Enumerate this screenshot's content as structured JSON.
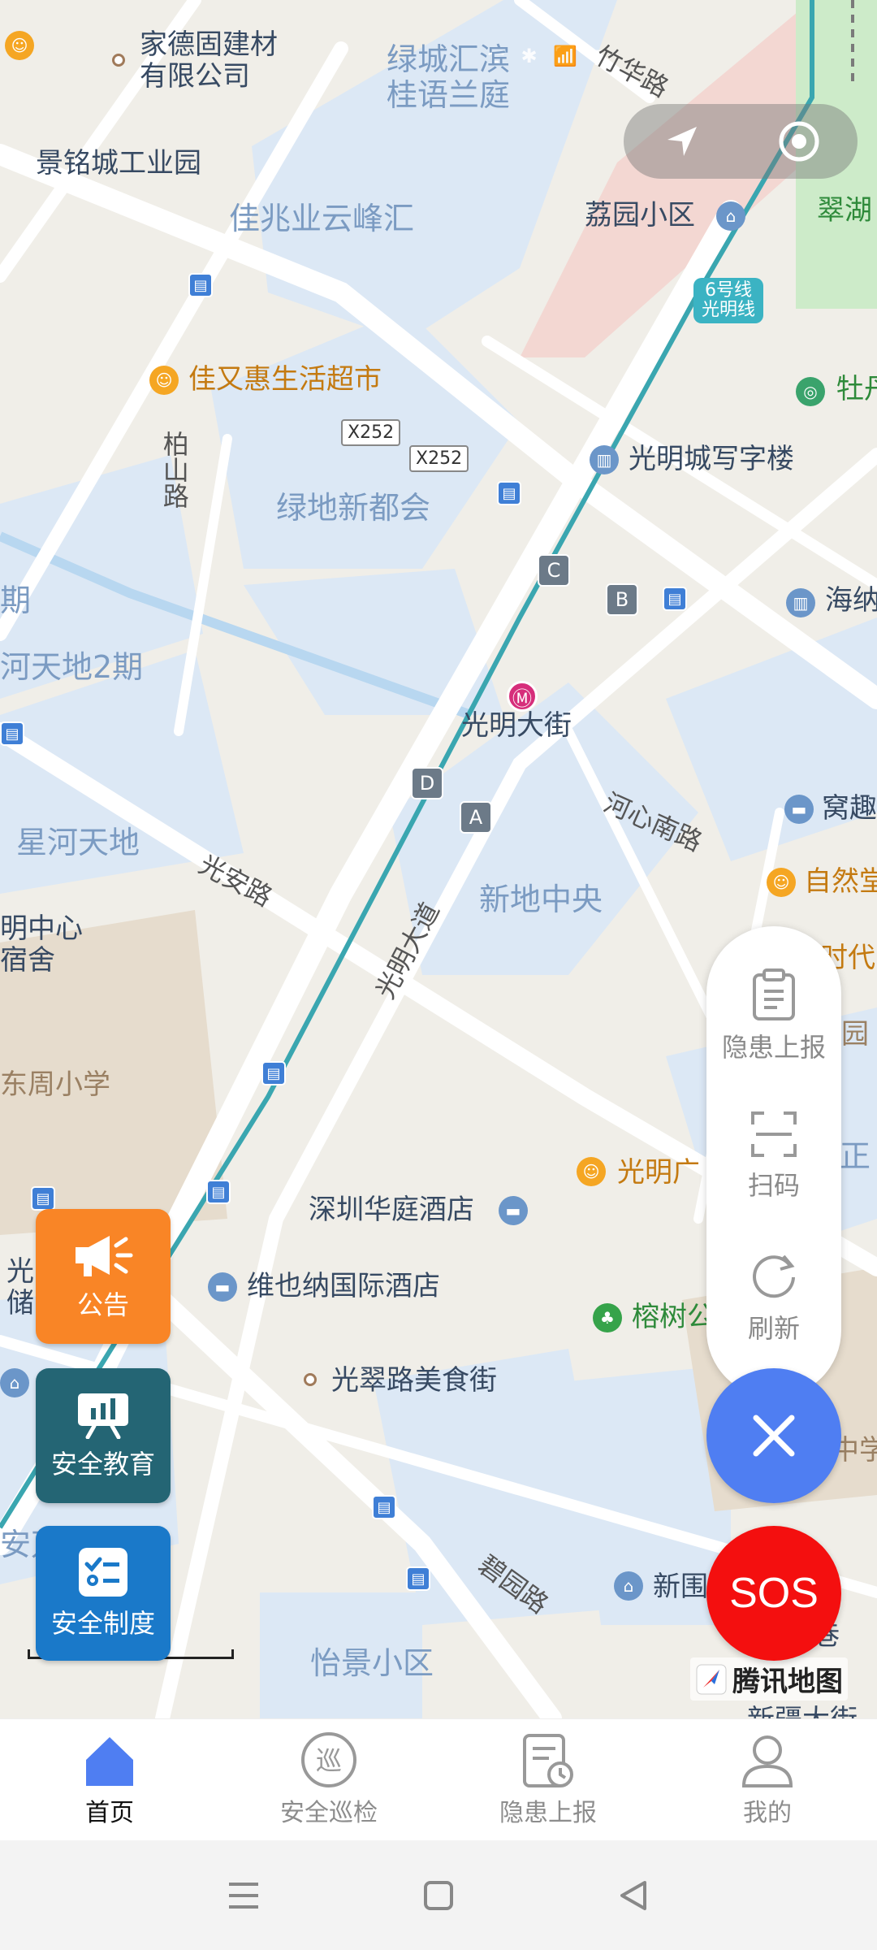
{
  "status_bar": {
    "icons_text": "ᯤ ✱ 📶 ▮"
  },
  "map": {
    "labels": [
      {
        "text": "家德固建材\n有限公司"
      },
      {
        "text": "绿城汇滨\n桂语兰庭"
      },
      {
        "text": "竹华路"
      },
      {
        "text": "景铭城工业园"
      },
      {
        "text": "佳兆业云峰汇"
      },
      {
        "text": "荔园小区"
      },
      {
        "text": "翠湖"
      },
      {
        "text": "佳又惠生活超市"
      },
      {
        "text": "牡丹"
      },
      {
        "text": "柏山路"
      },
      {
        "text": "光明城写字楼"
      },
      {
        "text": "绿地新都会"
      },
      {
        "text": "期"
      },
      {
        "text": "海纳"
      },
      {
        "text": "河天地2期"
      },
      {
        "text": "光明大街"
      },
      {
        "text": "河心南路"
      },
      {
        "text": "窝趣"
      },
      {
        "text": "星河天地"
      },
      {
        "text": "光安路"
      },
      {
        "text": "自然堂"
      },
      {
        "text": "新地中央"
      },
      {
        "text": "明中心\n宿舍"
      },
      {
        "text": "光明大道"
      },
      {
        "text": "时代"
      },
      {
        "text": "园"
      },
      {
        "text": "东周小学"
      },
      {
        "text": "光明广"
      },
      {
        "text": "正"
      },
      {
        "text": "深圳华庭酒店"
      },
      {
        "text": "光\n储"
      },
      {
        "text": "维也纳国际酒店"
      },
      {
        "text": "榕树公"
      },
      {
        "text": "光翠路美食街"
      },
      {
        "text": "中学"
      },
      {
        "text": "安万庭"
      },
      {
        "text": "碧园路"
      },
      {
        "text": "新围"
      },
      {
        "text": "巷"
      },
      {
        "text": "怡景小区"
      },
      {
        "text": "新疆大街"
      }
    ],
    "road_shields": [
      "X252",
      "X252"
    ],
    "metro_line": "6号线\n光明线",
    "station_exits": [
      "C",
      "B",
      "D",
      "A"
    ]
  },
  "fab_menu": {
    "items": [
      {
        "label": "隐患上报",
        "icon": "clipboard-icon"
      },
      {
        "label": "扫码",
        "icon": "scan-icon"
      },
      {
        "label": "刷新",
        "icon": "refresh-icon"
      }
    ],
    "close_icon": "close-icon",
    "sos_label": "SOS"
  },
  "quick_actions": [
    {
      "label": "公告",
      "icon": "megaphone-icon"
    },
    {
      "label": "安全教育",
      "icon": "presentation-icon"
    },
    {
      "label": "安全制度",
      "icon": "checklist-icon"
    }
  ],
  "map_provider": "腾讯地图",
  "tabs": [
    {
      "label": "首页",
      "icon": "home-icon",
      "active": true
    },
    {
      "label": "安全巡检",
      "icon": "patrol-icon",
      "active": false
    },
    {
      "label": "隐患上报",
      "icon": "report-icon",
      "active": false
    },
    {
      "label": "我的",
      "icon": "user-icon",
      "active": false
    }
  ],
  "colors": {
    "accent_blue": "#4f7ef2",
    "sos_red": "#f40f0f",
    "notice_orange": "#f98526",
    "edu_teal": "#246574",
    "rules_blue": "#1a79c9"
  }
}
